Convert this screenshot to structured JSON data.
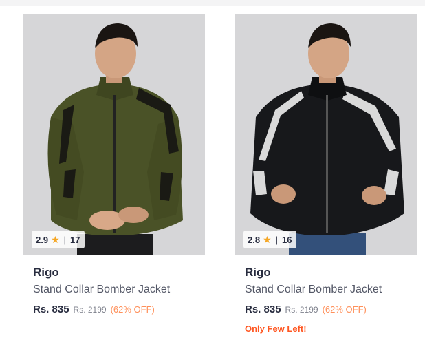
{
  "products": [
    {
      "rating": "2.9",
      "rating_count": "17",
      "brand": "Rigo",
      "name": "Stand Collar Bomber Jacket",
      "price": "Rs. 835",
      "mrp": "Rs. 2199",
      "discount": "(62% OFF)",
      "stock_note": "",
      "jacket_color": "#4a5227",
      "stripe_color": "#1a1a14",
      "pants_color": "#1c1c1e"
    },
    {
      "rating": "2.8",
      "rating_count": "16",
      "brand": "Rigo",
      "name": "Stand Collar Bomber Jacket",
      "price": "Rs. 835",
      "mrp": "Rs. 2199",
      "discount": "(62% OFF)",
      "stock_note": "Only Few Left!",
      "jacket_color": "#17181b",
      "stripe_color": "#d9d9d9",
      "pants_color": "#33507a"
    }
  ],
  "colors": {
    "star": "#f5a623",
    "discount": "#ff905a",
    "stock_warning": "#ff5722",
    "image_background": "#d6d6d8"
  },
  "icons": {
    "rating": "star-icon"
  }
}
